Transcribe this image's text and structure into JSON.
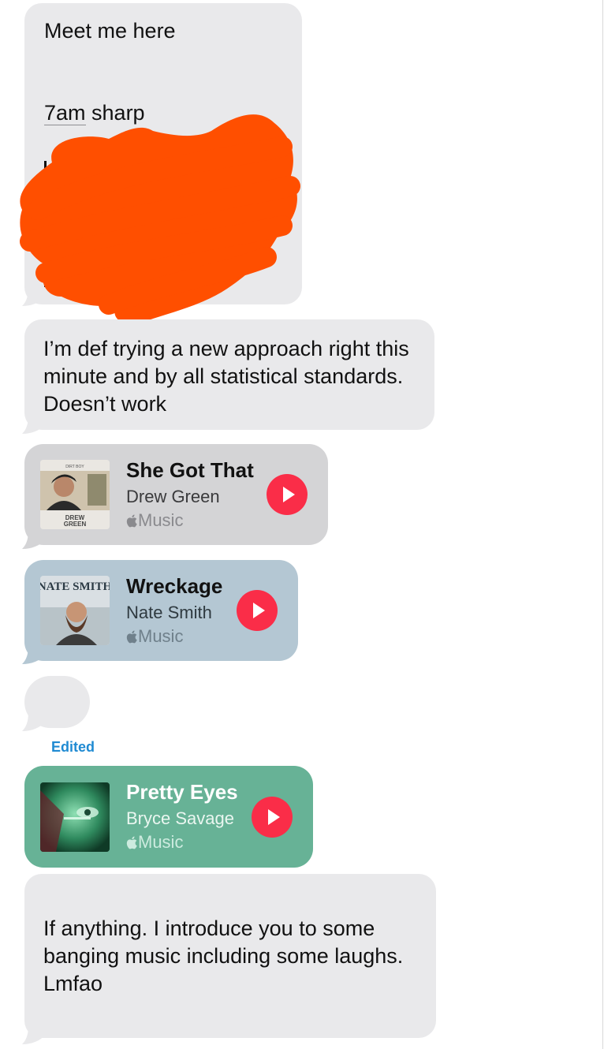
{
  "messages": {
    "first": {
      "line1": "Meet me here",
      "line2_time": "7am",
      "line2_rest": " sharp"
    },
    "second": "I’m def trying a new approach right this minute and by all statistical standards. Doesn’t work",
    "last": "If anything. I introduce you to some banging music including some laughs.\nLmfao",
    "edited_label": "Edited"
  },
  "music_cards": [
    {
      "song": "She Got That",
      "artist": "Drew Green",
      "service": "Music",
      "art_text_top": "DIRT BOY",
      "art_text_bottom": "DREW GREEN"
    },
    {
      "song": "Wreckage",
      "artist": "Nate Smith",
      "service": "Music",
      "art_text_top": "NATE SMITH"
    },
    {
      "song": "Pretty Eyes",
      "artist": "Bryce Savage",
      "service": "Music"
    }
  ],
  "colors": {
    "bubble_gray": "#e9e9eb",
    "play_red": "#fa2d48",
    "redaction_orange": "#ff4f00",
    "edited_blue": "#1f8ad2"
  }
}
